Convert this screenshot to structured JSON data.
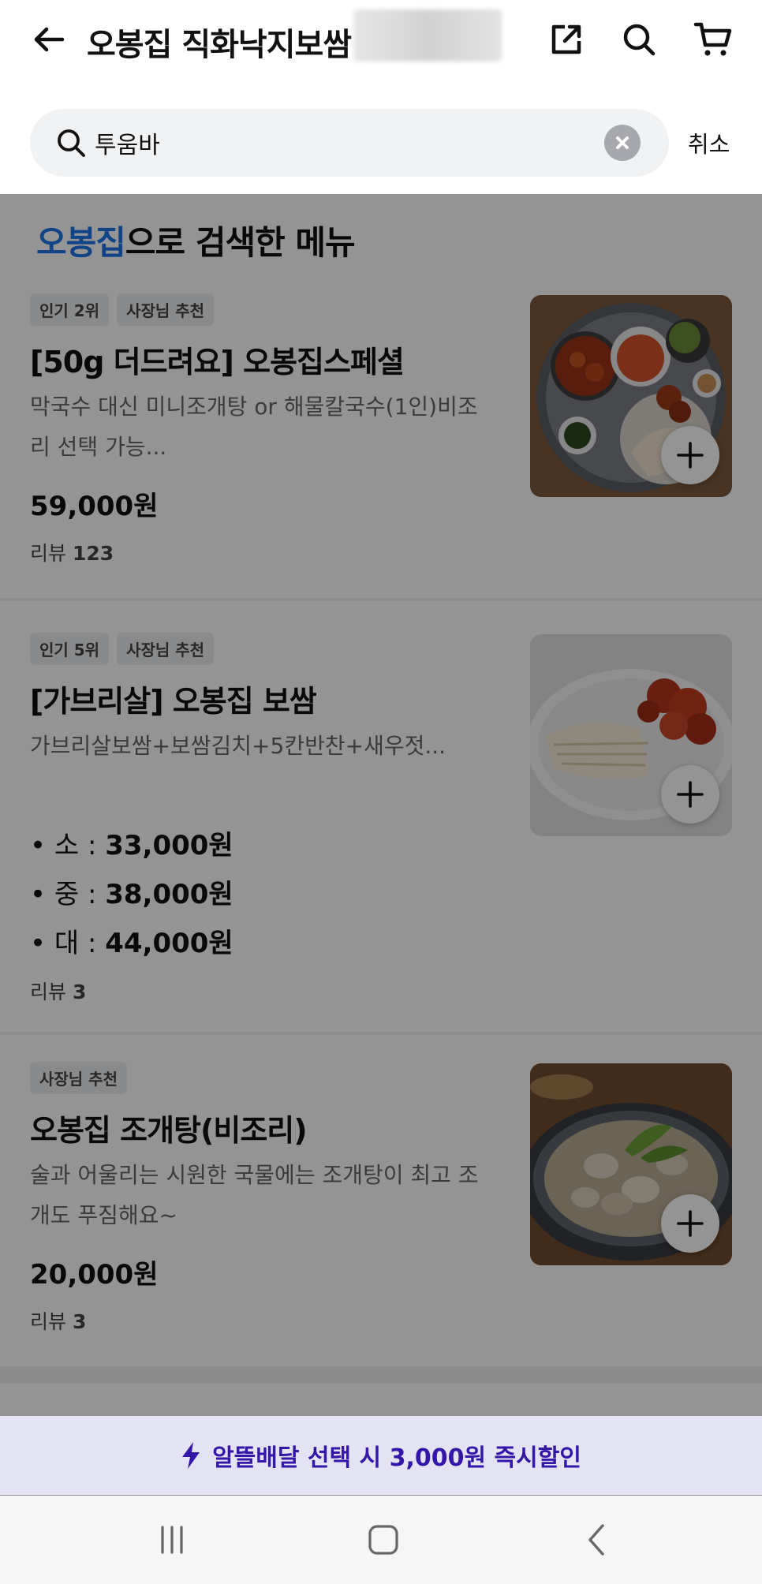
{
  "header": {
    "title": "오봉집 직화낙지보쌈",
    "back_icon": "arrow-left-icon",
    "share_icon": "share-icon",
    "search_icon": "search-icon",
    "cart_icon": "cart-icon"
  },
  "search": {
    "value": "투움바",
    "placeholder": "",
    "cancel_label": "취소"
  },
  "section": {
    "title_accent": "오봉집",
    "title_rest": "으로 검색한 메뉴"
  },
  "items": [
    {
      "badges": [
        "인기 2위",
        "사장님 추천"
      ],
      "name": "[50g 더드려요] 오봉집스페셜",
      "desc": "막국수 대신 미니조개탕 or 해물칼국수(1인)비조리 선택 가능...",
      "price": "59,000원",
      "review_label": "리뷰",
      "review_count": "123"
    },
    {
      "badges": [
        "인기 5위",
        "사장님 추천"
      ],
      "name": "[가브리살] 오봉집 보쌈",
      "desc": "가브리살보쌈+보쌈김치+5칸반찬+새우젓...",
      "options": [
        {
          "label": "• 소 : ",
          "price": "33,000원"
        },
        {
          "label": "• 중 : ",
          "price": "38,000원"
        },
        {
          "label": "• 대 : ",
          "price": "44,000원"
        }
      ],
      "review_label": "리뷰",
      "review_count": "3"
    },
    {
      "badges": [
        "사장님 추천"
      ],
      "name": "오봉집 조개탕(비조리)",
      "desc": "술과 어울리는 시원한 국물에는 조개탕이 최고 조개도 푸짐해요~",
      "price": "20,000원",
      "review_label": "리뷰",
      "review_count": "3"
    }
  ],
  "promo": {
    "icon": "lightning-icon",
    "text": "알뜰배달 선택 시 3,000원 즉시할인"
  },
  "navbar": {
    "recent_icon": "recent-apps-icon",
    "home_icon": "home-icon",
    "back_icon": "back-chevron-icon"
  },
  "colors": {
    "accent": "#1e74e8",
    "promo_text": "#3417a8",
    "promo_bg": "#e4e3f4"
  }
}
